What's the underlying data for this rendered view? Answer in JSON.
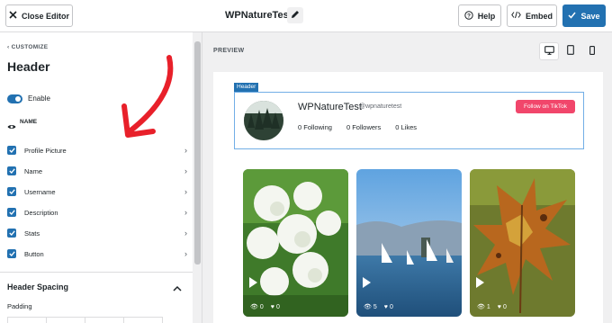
{
  "topbar": {
    "close_label": "Close Editor",
    "feed_title": "WPNatureTest",
    "help_label": "Help",
    "embed_label": "Embed",
    "save_label": "Save"
  },
  "sidebar": {
    "breadcrumb": "CUSTOMIZE",
    "heading": "Header",
    "enable_label": "Enable",
    "name_label": "NAME",
    "items": [
      {
        "label": "Profile Picture",
        "checked": true
      },
      {
        "label": "Name",
        "checked": true
      },
      {
        "label": "Username",
        "checked": true
      },
      {
        "label": "Description",
        "checked": true
      },
      {
        "label": "Stats",
        "checked": true
      },
      {
        "label": "Button",
        "checked": true
      }
    ],
    "spacing_label": "Header Spacing",
    "padding_label": "Padding"
  },
  "preview": {
    "label": "PREVIEW",
    "header_tag": "Header",
    "account_name": "WPNatureTest",
    "account_handle": "@wpnaturetest",
    "following": "0 Following",
    "followers": "0 Followers",
    "likes": "0 Likes",
    "follow_button": "Follow on TikTok",
    "videos": [
      {
        "views": "0",
        "likes": "0"
      },
      {
        "views": "5",
        "likes": "0"
      },
      {
        "views": "1",
        "likes": "0"
      }
    ]
  },
  "colors": {
    "accent": "#2271b1",
    "tiktok": "#f1466b",
    "annotation": "#e8202a"
  }
}
